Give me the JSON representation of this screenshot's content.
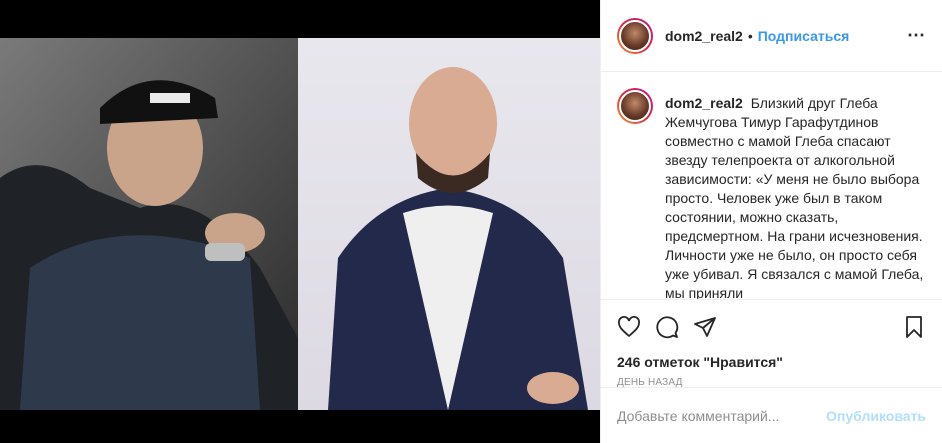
{
  "header": {
    "username": "dom2_real2",
    "separator": "•",
    "follow_label": "Подписаться",
    "more_icon": "⋯"
  },
  "caption": {
    "username": "dom2_real2",
    "text": "Близкий друг Глеба Жемчугова Тимур Гарафутдинов совместно с мамой Глеба спасают звезду телепроекта от алкогольной зависимости: «У меня не было выбора просто. Человек уже был в таком состоянии, можно сказать, предсмертном. На грани исчезновения. Личности уже не было, он просто себя уже убивал. Я связался с мамой Глеба, мы приняли"
  },
  "stats": {
    "likes": "246 отметок \"Нравится\"",
    "time": "ДЕНЬ НАЗАД"
  },
  "comment_box": {
    "placeholder": "Добавьте комментарий...",
    "post_label": "Опубликовать"
  },
  "colors": {
    "accent": "#3897f0",
    "post_disabled": "#b2dffc",
    "muted": "#8e8e8e"
  },
  "icons": [
    "heart-icon",
    "comment-icon",
    "share-icon",
    "bookmark-icon"
  ]
}
